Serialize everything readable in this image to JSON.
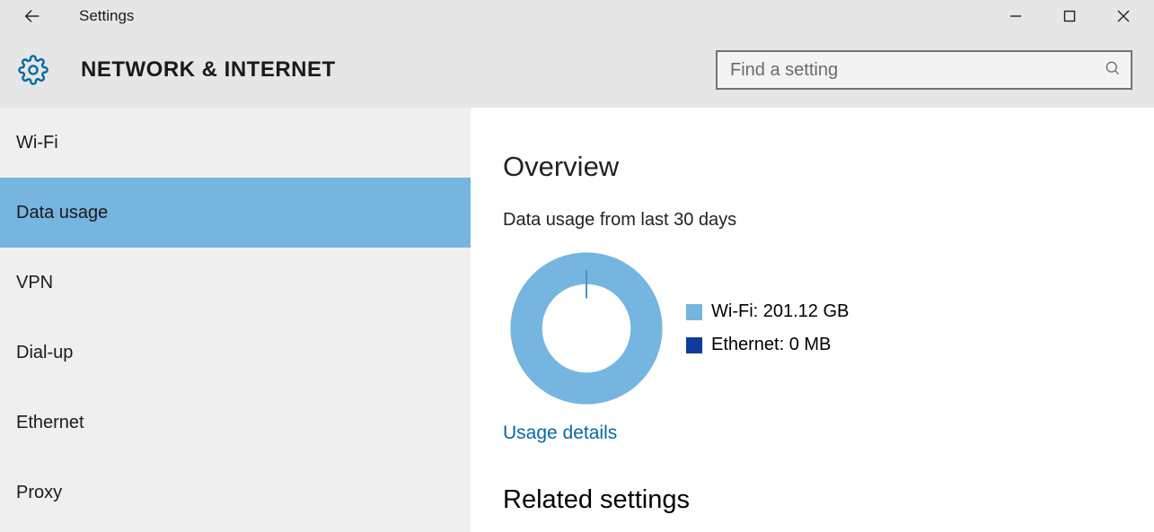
{
  "titlebar": {
    "title": "Settings"
  },
  "header": {
    "title": "NETWORK & INTERNET",
    "search_placeholder": "Find a setting"
  },
  "sidebar": {
    "items": [
      {
        "label": "Wi-Fi",
        "selected": false
      },
      {
        "label": "Data usage",
        "selected": true
      },
      {
        "label": "VPN",
        "selected": false
      },
      {
        "label": "Dial-up",
        "selected": false
      },
      {
        "label": "Ethernet",
        "selected": false
      },
      {
        "label": "Proxy",
        "selected": false
      }
    ]
  },
  "main": {
    "overview_heading": "Overview",
    "usage_subtext": "Data usage from last 30 days",
    "legend": {
      "wifi_label": "Wi-Fi: 201.12 GB",
      "ethernet_label": "Ethernet: 0 MB"
    },
    "usage_details_link": "Usage details",
    "related_heading": "Related settings"
  },
  "chart_data": {
    "type": "pie",
    "title": "Data usage from last 30 days",
    "series": [
      {
        "name": "Wi-Fi",
        "value": 201.12,
        "unit": "GB",
        "color": "#76b5e0"
      },
      {
        "name": "Ethernet",
        "value": 0,
        "unit": "MB",
        "color": "#0f3b9b"
      }
    ]
  },
  "colors": {
    "accent_blue": "#0269a8",
    "selection_blue": "#76b5e0",
    "ethernet_blue": "#0f3b9b"
  }
}
